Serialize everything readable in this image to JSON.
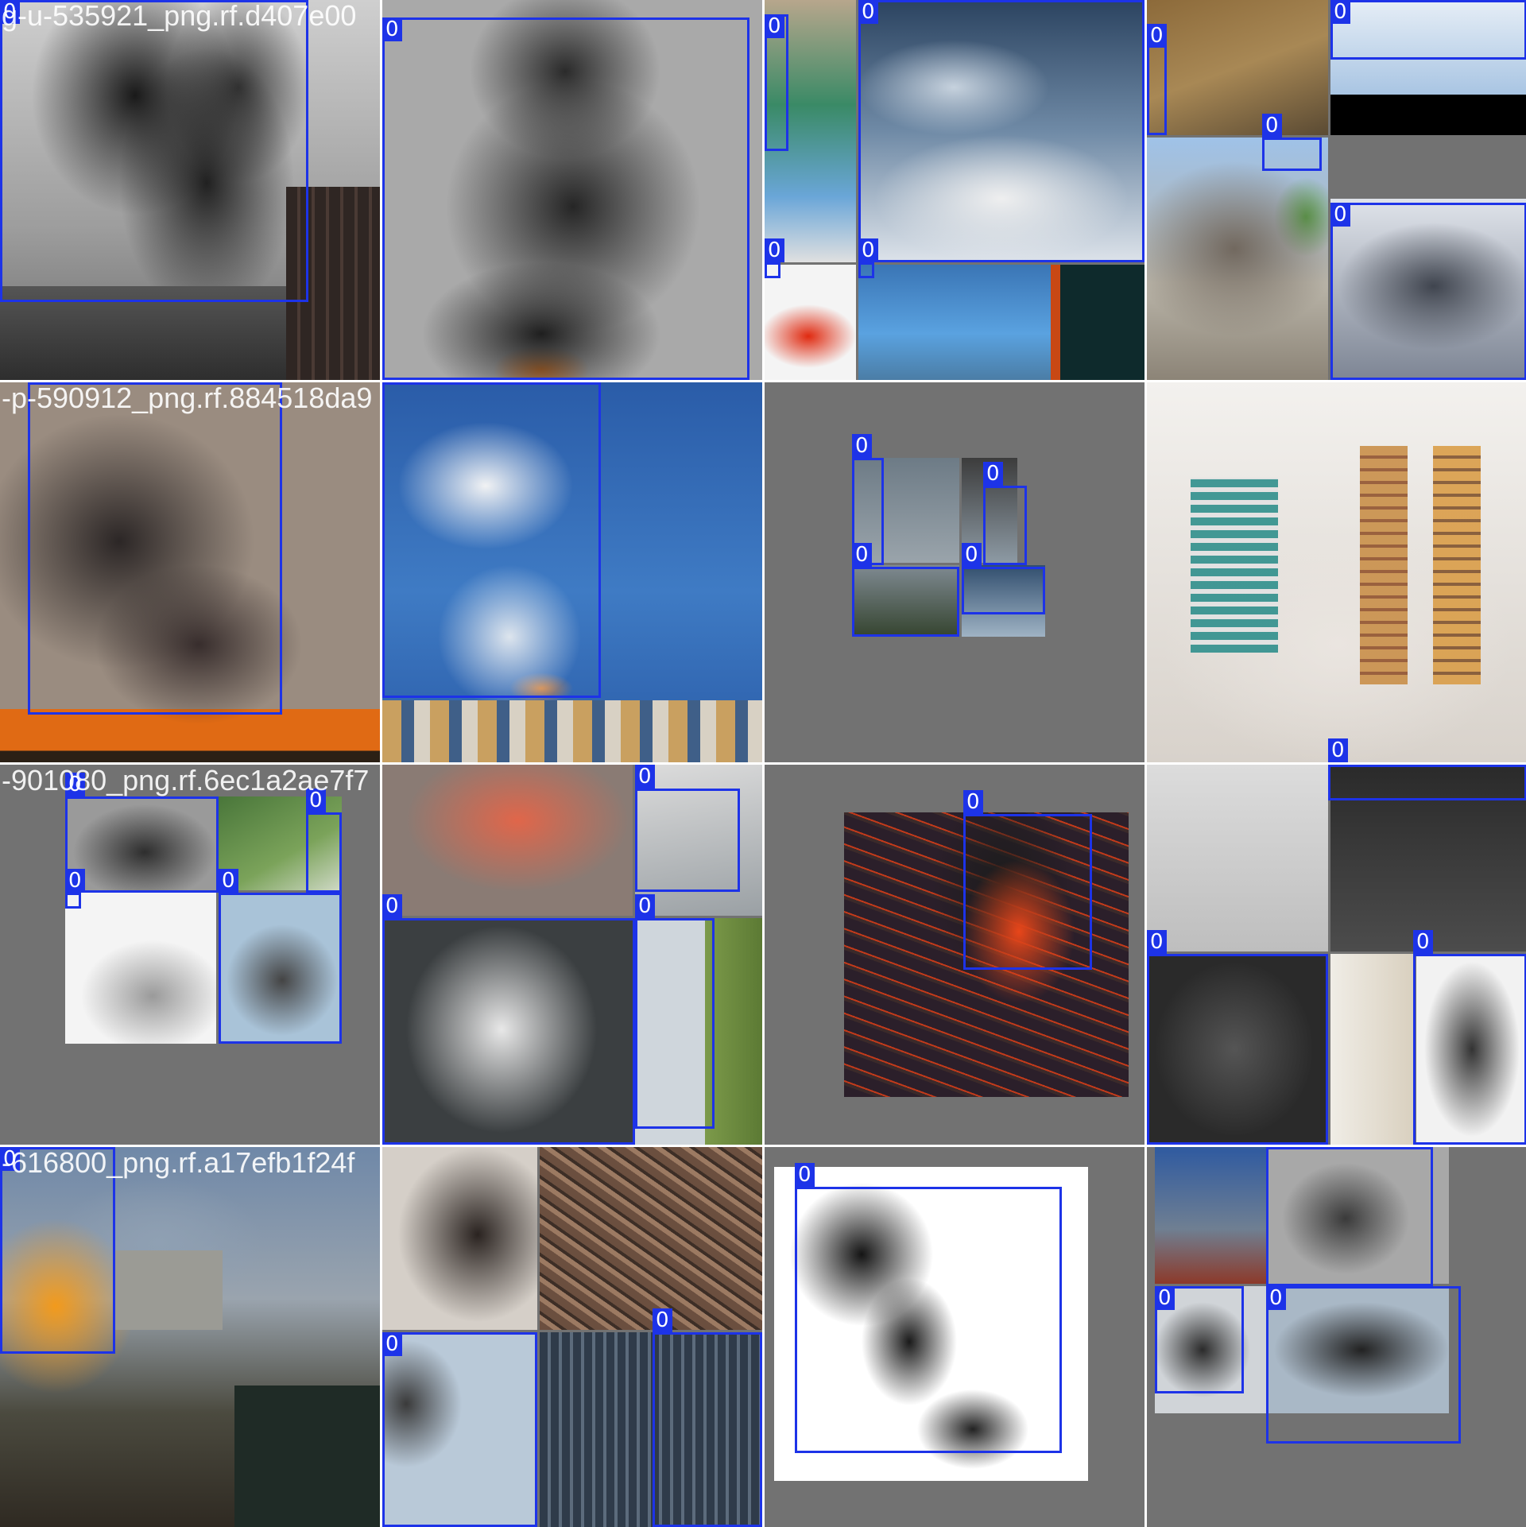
{
  "mosaic": {
    "class_label": "0",
    "box_color": "#1d33e8",
    "tiles": [
      {
        "name": "tile-r1c1",
        "caption": "g-u-535921_png.rf.d407e00",
        "scene": "black smoke plume over city buildings",
        "box_count": 1
      },
      {
        "name": "tile-r1c2",
        "caption": "",
        "scene": "black billowing smoke column",
        "box_count": 1
      },
      {
        "name": "tile-r1c3",
        "caption": "",
        "scene": "mosaic of smoke and sky crops",
        "box_count": 4
      },
      {
        "name": "tile-r1c4",
        "caption": "",
        "scene": "mosaic of road, smoke and clouds",
        "box_count": 4
      },
      {
        "name": "tile-r2c1",
        "caption": "-p-590912_png.rf.884518da9",
        "scene": "dark smoke over field fire",
        "box_count": 1
      },
      {
        "name": "tile-r2c2",
        "caption": "",
        "scene": "white smoke mushroom over city",
        "box_count": 1
      },
      {
        "name": "tile-r2c3",
        "caption": "",
        "scene": "small mosaic on grey padding",
        "box_count": 4
      },
      {
        "name": "tile-r2c4",
        "caption": "",
        "scene": "high-rise buildings in haze",
        "box_count": 1
      },
      {
        "name": "tile-r3c1",
        "caption": "-901080_png.rf.6ec1a2ae7f7",
        "scene": "mosaic of smoke crops",
        "box_count": 4
      },
      {
        "name": "tile-r3c2",
        "caption": "",
        "scene": "orange fire glow and smoke trails",
        "box_count": 4
      },
      {
        "name": "tile-r3c3",
        "caption": "",
        "scene": "night aerial view of factory fire",
        "box_count": 1
      },
      {
        "name": "tile-r3c4",
        "caption": "",
        "scene": "mosaic of grey smoke crops",
        "box_count": 3
      },
      {
        "name": "tile-r4c1",
        "caption": "-616800_png.rf.a17efb1f24f",
        "scene": "burning debris on village street",
        "box_count": 1
      },
      {
        "name": "tile-r4c2",
        "caption": "",
        "scene": "mosaic of smoke and building crops",
        "box_count": 3
      },
      {
        "name": "tile-r4c3",
        "caption": "",
        "scene": "black smoke silhouette on white",
        "box_count": 1
      },
      {
        "name": "tile-r4c4",
        "caption": "",
        "scene": "smoke over industrial site mosaic",
        "box_count": 3
      }
    ]
  }
}
